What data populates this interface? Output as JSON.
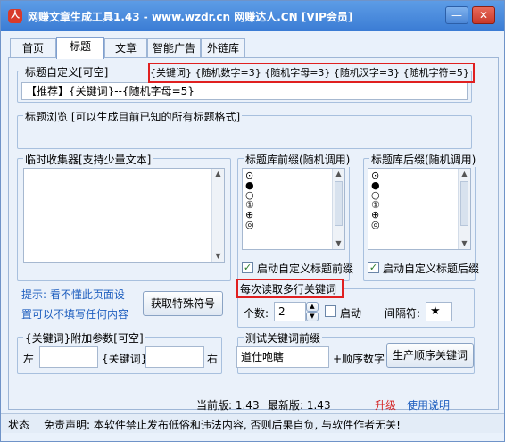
{
  "window": {
    "title": "网赚文章生成工具1.43 - www.wzdr.cn 网赚达人.CN [VIP会员]",
    "app_icon": "人",
    "minimize_glyph": "—",
    "close_glyph": "✕"
  },
  "tabs": [
    "首页",
    "标题",
    "文章",
    "智能广告",
    "外链库"
  ],
  "title_custom": {
    "label": "标题自定义[可空]",
    "syntax_hint": "{关键词} {随机数字=3} {随机字母=3} {随机汉字=3} {随机字符=5}",
    "value": "【推荐】{关键词}--{随机字母=5}"
  },
  "title_browse": {
    "label": "标题浏览 [可以生成目前已知的所有标题格式]"
  },
  "temp_collector": {
    "label": "临时收集器[支持少量文本]"
  },
  "prefix_lib": {
    "label": "标题库前缀(随机调用)",
    "items": [
      "⊙",
      "●",
      "○",
      "①",
      "⊕",
      "◎"
    ],
    "checkbox_label": "启动自定义标题前缀",
    "checked": true
  },
  "suffix_lib": {
    "label": "标题库后缀(随机调用)",
    "items": [
      "⊙",
      "●",
      "○",
      "①",
      "⊕",
      "◎"
    ],
    "checkbox_label": "启动自定义标题后缀",
    "checked": true
  },
  "tip": {
    "line1": "提示: 看不懂此页面设",
    "line2": "置可以不填写任何内容"
  },
  "special_symbol_button": "获取特殊符号",
  "multi_keyword": {
    "label": "每次读取多行关键词",
    "count_label": "个数:",
    "count_value": "2",
    "enable_label": "启动",
    "separator_label": "间隔符:",
    "separator_value": "★"
  },
  "keyword_params": {
    "label": "{关键词}附加参数[可空]",
    "left_label": "左",
    "middle_label": "{关键词}",
    "right_label": "右"
  },
  "test_prefix": {
    "label": "测试关键词前缀",
    "value": "道仕咆瞎",
    "order_label": "+顺序数字",
    "button": "生产顺序关键词"
  },
  "version": {
    "current_label": "当前版: 1.43",
    "latest_label": "最新版: 1.43",
    "upgrade": "升级",
    "help": "使用说明"
  },
  "status": {
    "label": "状态",
    "disclaimer": "免责声明: 本软件禁止发布低俗和违法内容, 否则后果自负, 与软件作者无关!"
  },
  "colors": {
    "titlebar": "#3b7cd4",
    "highlight": "#e02020",
    "link": "#1f5fbf",
    "version_number": "#d42020"
  }
}
